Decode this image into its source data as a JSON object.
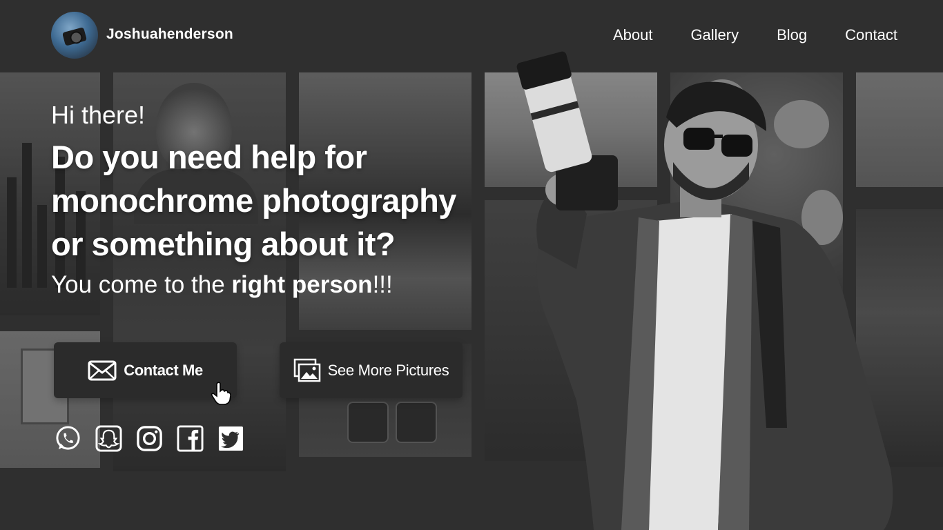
{
  "header": {
    "brand_name": "Joshuahenderson",
    "nav": [
      {
        "label": "About"
      },
      {
        "label": "Gallery"
      },
      {
        "label": "Blog"
      },
      {
        "label": "Contact"
      }
    ]
  },
  "hero": {
    "greeting": "Hi there!",
    "headline_lines": [
      "Do you need help for",
      "monochrome photography",
      "or something about it?"
    ],
    "tagline_prefix": "You come to the ",
    "tagline_bold": "right person",
    "tagline_suffix": "!!!"
  },
  "buttons": {
    "contact_label": "Contact Me",
    "gallery_label": "See More Pictures"
  },
  "socials": [
    {
      "icon": "whatsapp-icon"
    },
    {
      "icon": "snapchat-icon"
    },
    {
      "icon": "instagram-icon"
    },
    {
      "icon": "facebook-icon"
    },
    {
      "icon": "twitter-icon"
    }
  ],
  "colors": {
    "background": "#2f2f2f",
    "button_bg": "#2b2b2b",
    "text": "#ffffff"
  }
}
